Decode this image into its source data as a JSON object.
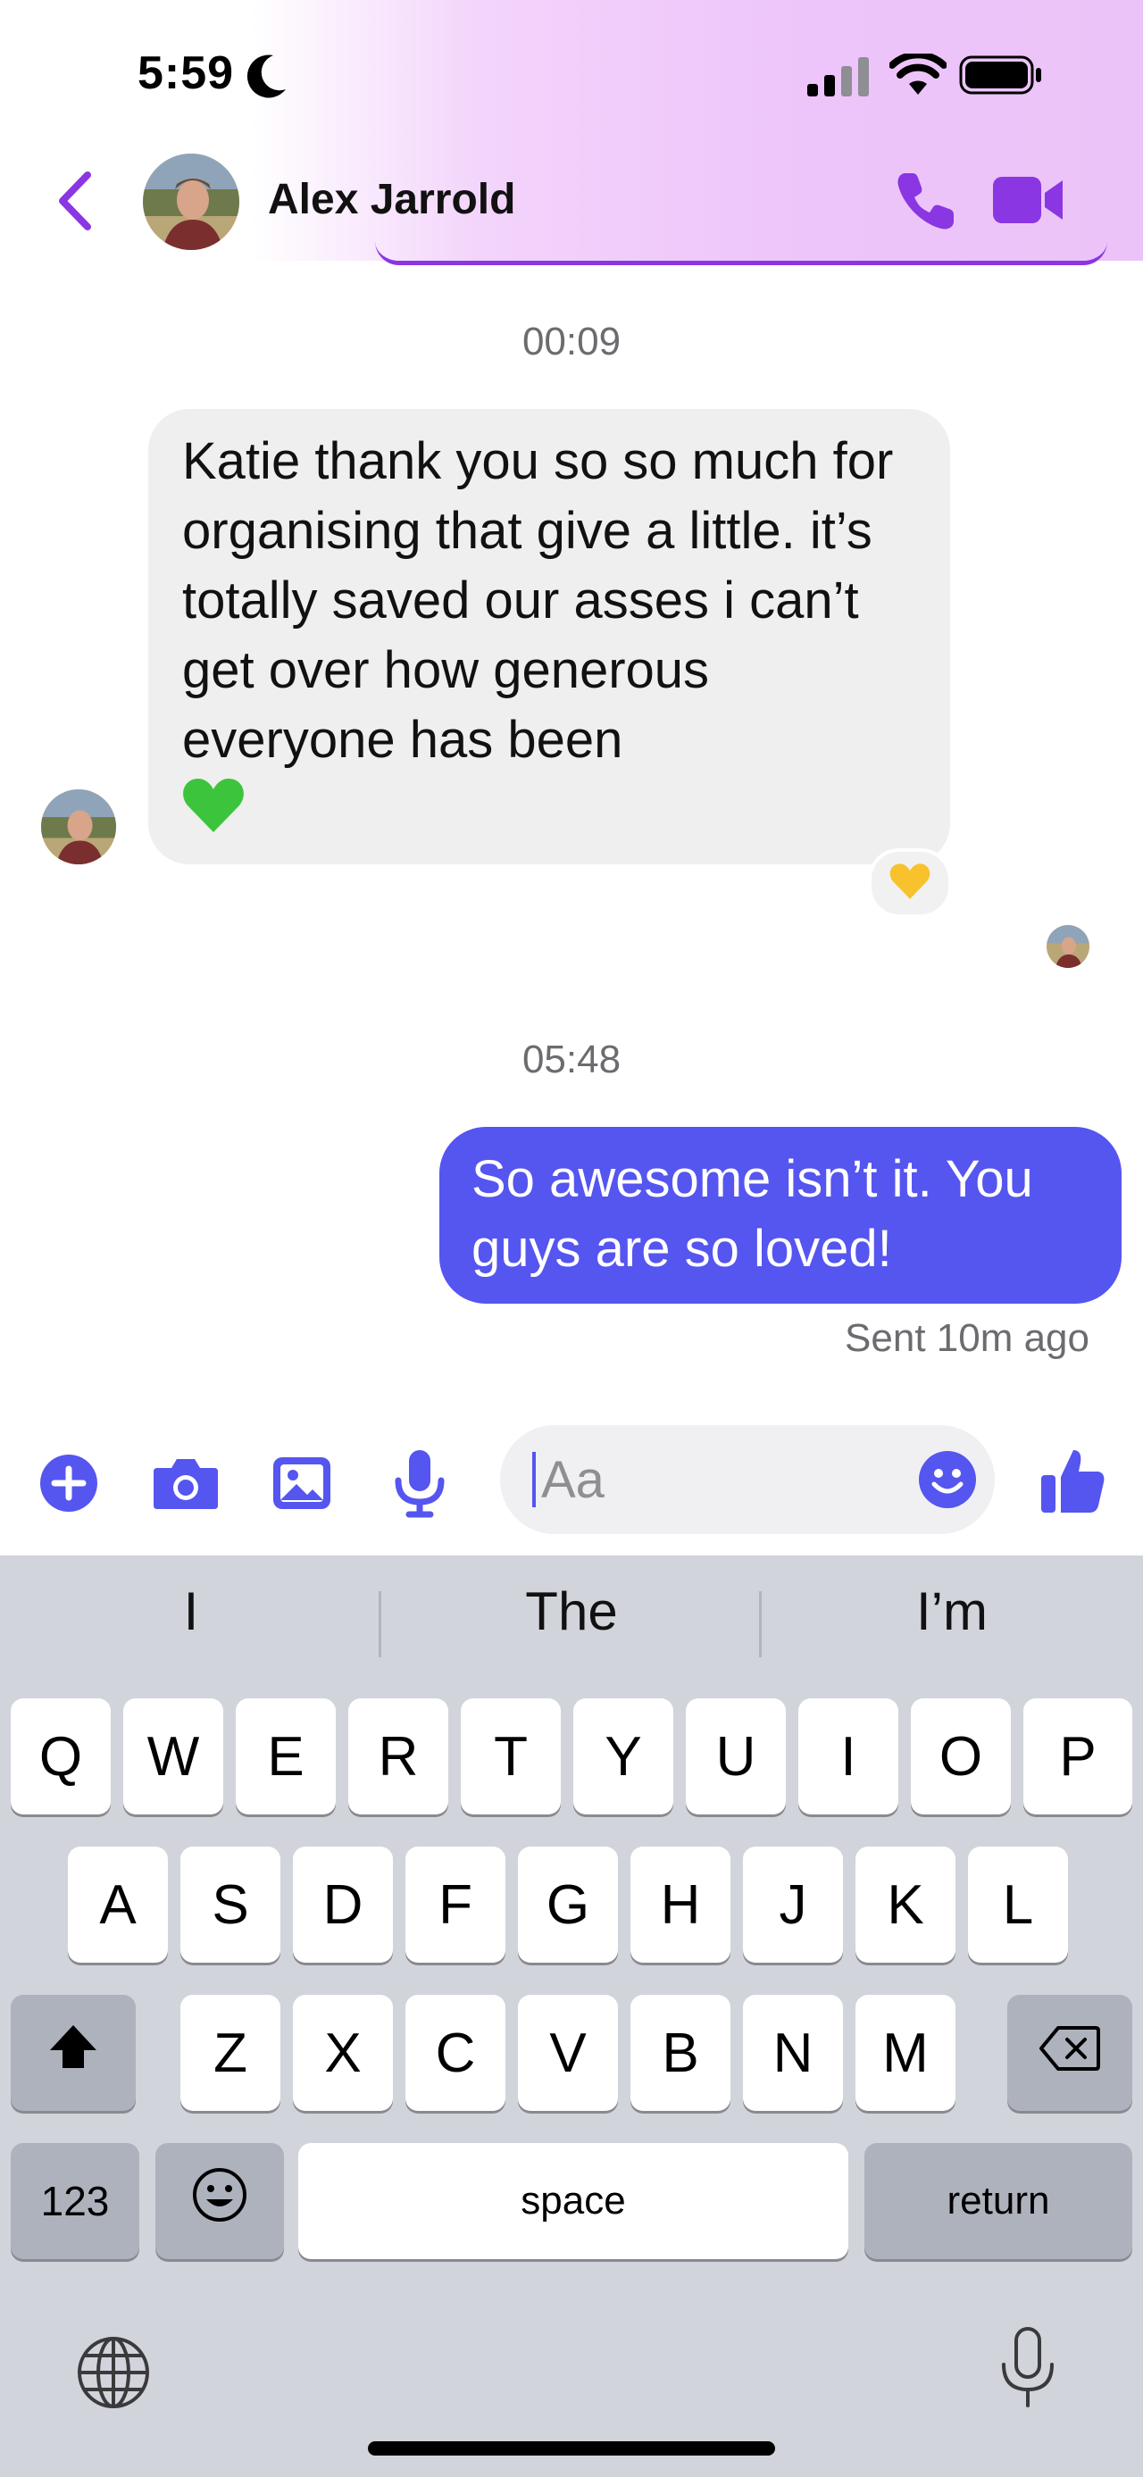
{
  "status_bar": {
    "time": "5:59"
  },
  "header": {
    "contact_name": "Alex Jarrold"
  },
  "messages": [
    {
      "type": "timestamp",
      "text": "00:09"
    },
    {
      "type": "incoming",
      "text": "Katie thank you so so much for organising that give a little. it’s totally saved our asses i can’t get over how generous everyone has been",
      "emoji": "green-heart",
      "reaction": "yellow-heart"
    },
    {
      "type": "timestamp",
      "text": "05:48"
    },
    {
      "type": "outgoing",
      "text": "So awesome isn’t it. You guys are so loved!",
      "status": "Sent 10m ago"
    }
  ],
  "composer": {
    "placeholder": "Aa"
  },
  "keyboard": {
    "predictions": [
      "I",
      "The",
      "I’m"
    ],
    "row1": [
      "Q",
      "W",
      "E",
      "R",
      "T",
      "Y",
      "U",
      "I",
      "O",
      "P"
    ],
    "row2": [
      "A",
      "S",
      "D",
      "F",
      "G",
      "H",
      "J",
      "K",
      "L"
    ],
    "row3": [
      "Z",
      "X",
      "C",
      "V",
      "B",
      "N",
      "M"
    ],
    "numbers_label": "123",
    "space_label": "space",
    "return_label": "return"
  },
  "colors": {
    "accent": "#8a36e3",
    "outgoing_bubble": "#5555f0",
    "icon_blue": "#5555f0"
  }
}
